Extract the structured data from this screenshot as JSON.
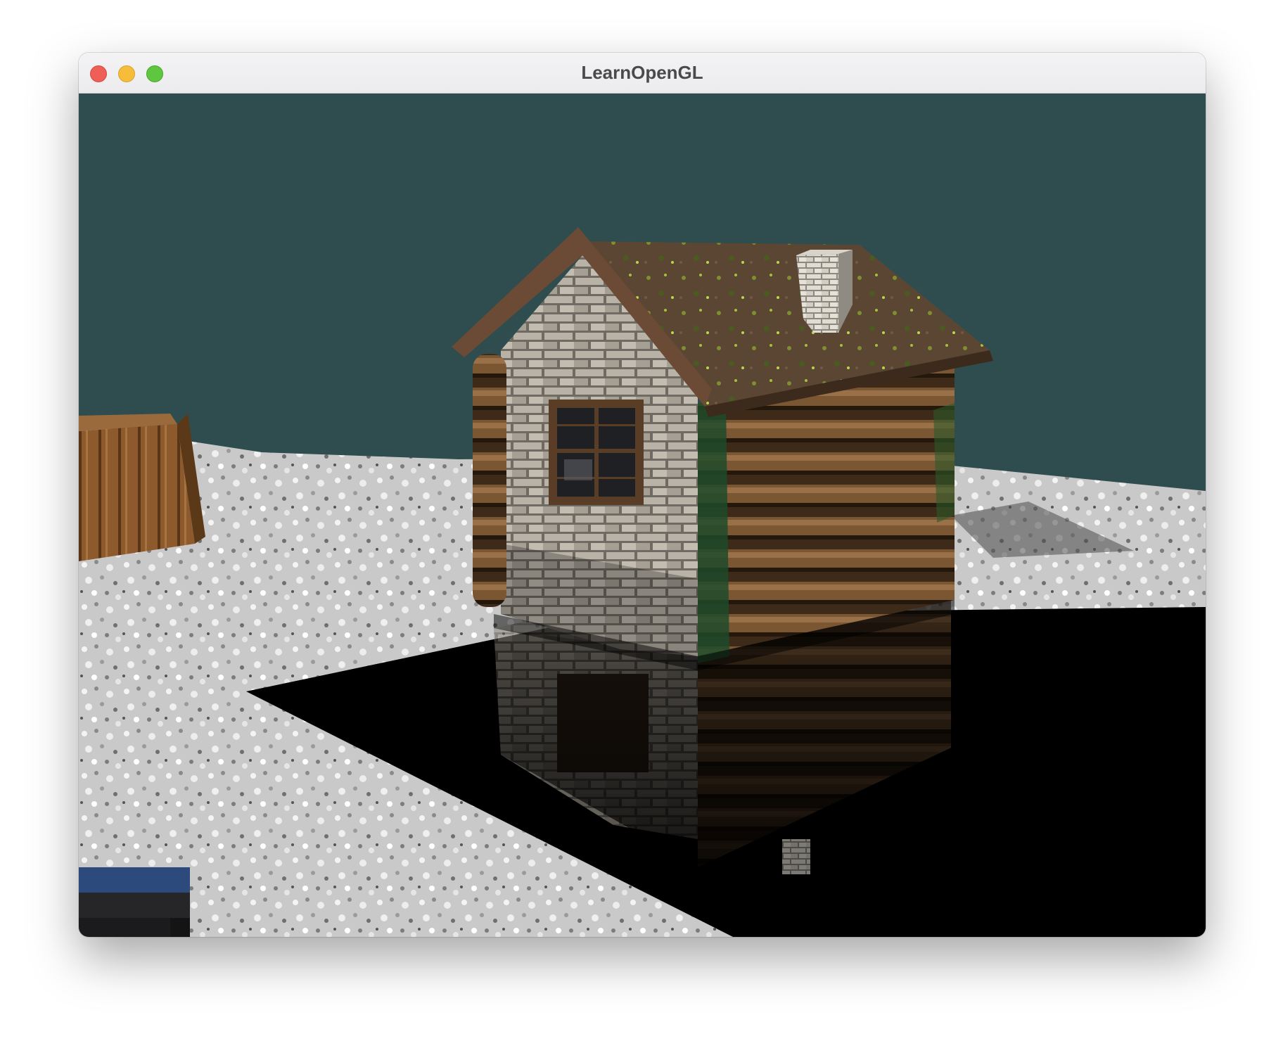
{
  "window": {
    "title": "LearnOpenGL"
  },
  "colors": {
    "clear_color": "#2f4d4e",
    "imgui_header": "#2c4a7c"
  },
  "icons": {
    "close": "close-button-red",
    "minimize": "minimize-button-yellow",
    "zoom": "zoom-button-green"
  }
}
